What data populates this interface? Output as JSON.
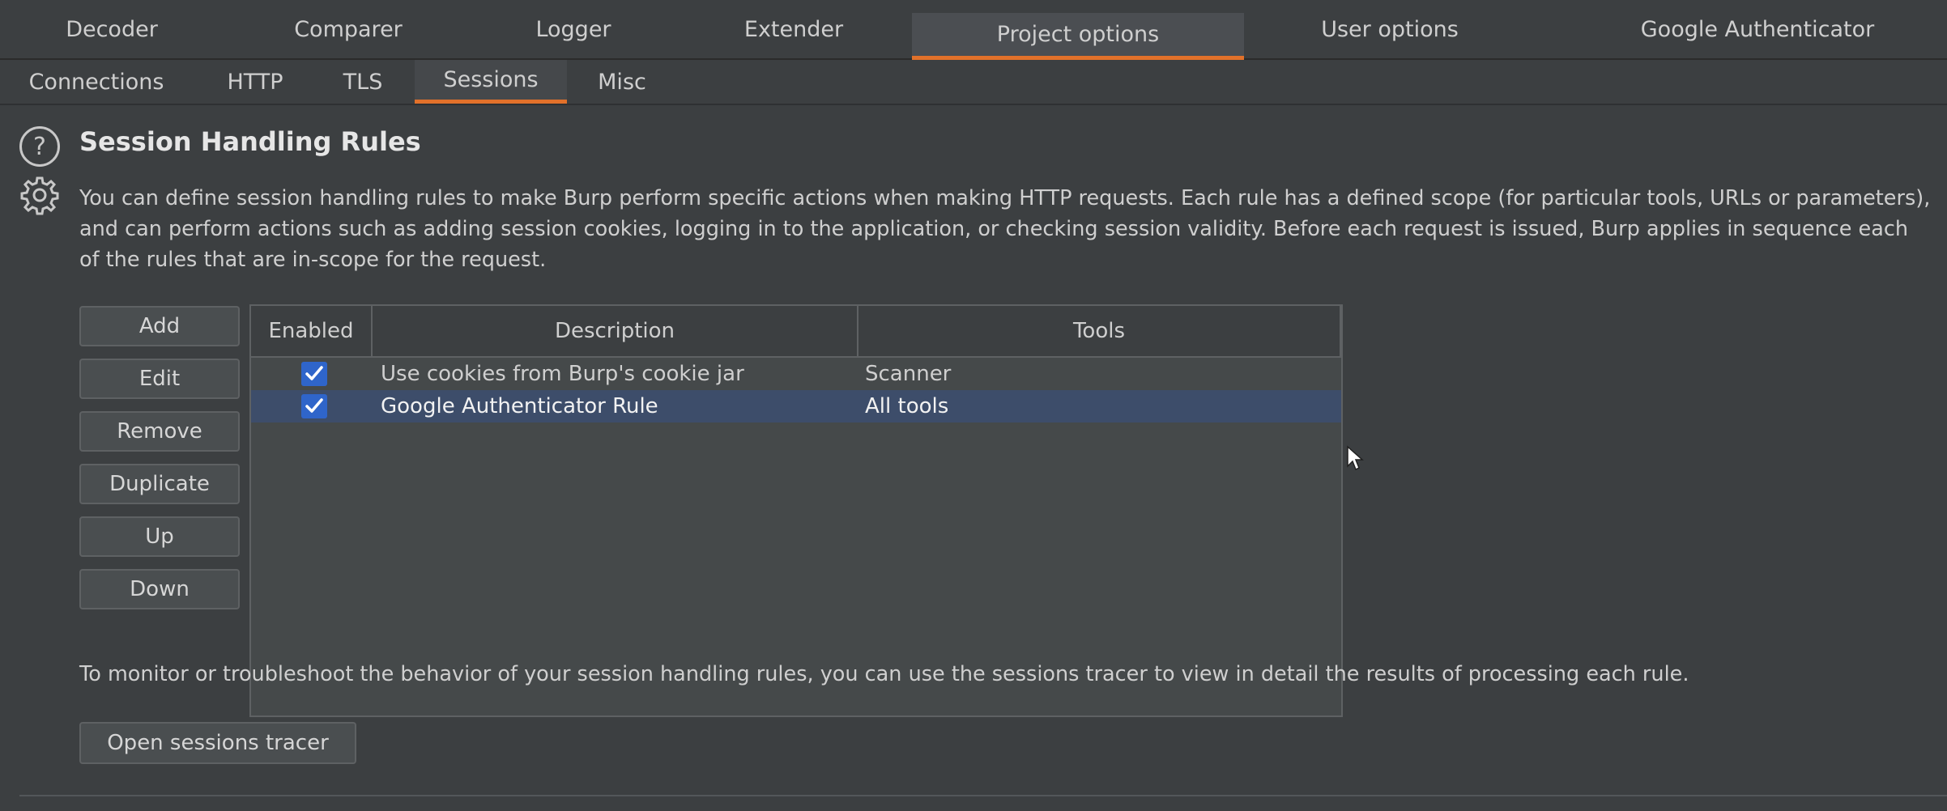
{
  "top_tabs": [
    {
      "label": "Decoder"
    },
    {
      "label": "Comparer"
    },
    {
      "label": "Logger"
    },
    {
      "label": "Extender"
    },
    {
      "label": "Project options",
      "active": true
    },
    {
      "label": "User options"
    },
    {
      "label": "Google Authenticator"
    }
  ],
  "sub_tabs": [
    {
      "label": "Connections"
    },
    {
      "label": "HTTP"
    },
    {
      "label": "TLS"
    },
    {
      "label": "Sessions",
      "active": true
    },
    {
      "label": "Misc"
    }
  ],
  "section": {
    "title": "Session Handling Rules",
    "description": "You can define session handling rules to make Burp perform specific actions when making HTTP requests. Each rule has a defined scope (for particular tools, URLs or parameters), and can perform actions such as adding session cookies, logging in to the application, or checking session validity. Before each request is issued, Burp applies in sequence each of the rules that are in-scope for the request.",
    "help_icon": "?"
  },
  "buttons": {
    "add": "Add",
    "edit": "Edit",
    "remove": "Remove",
    "duplicate": "Duplicate",
    "up": "Up",
    "down": "Down"
  },
  "table": {
    "columns": [
      "Enabled",
      "Description",
      "Tools"
    ],
    "rows": [
      {
        "enabled": true,
        "description": "Use cookies from Burp's cookie jar",
        "tools": "Scanner",
        "selected": false
      },
      {
        "enabled": true,
        "description": "Google Authenticator Rule",
        "tools": "All tools",
        "selected": true
      }
    ]
  },
  "tracer": {
    "note": "To monitor or troubleshoot the behavior of your session handling rules, you can use the sessions tracer to view in detail the results of processing each rule.",
    "button": "Open sessions tracer"
  },
  "colors": {
    "accent": "#e2712a",
    "selection": "#3d4d6a",
    "checkbox": "#2f65ca"
  },
  "icons": [
    "help-icon",
    "gear-icon",
    "check-icon",
    "mouse-cursor-icon"
  ]
}
